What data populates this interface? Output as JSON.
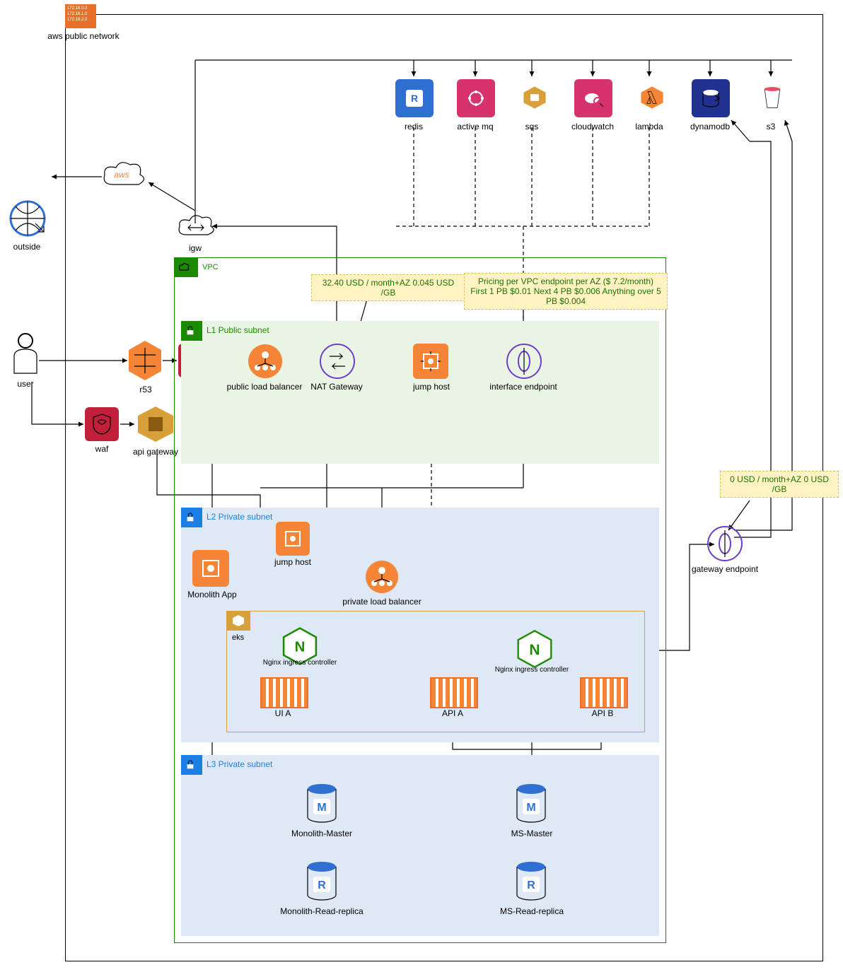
{
  "frame": {
    "aws_public_network": "aws public network"
  },
  "top_services": {
    "redis": "redis",
    "activemq": "active mq",
    "sqs": "sqs",
    "cloudwatch": "cloudwatch",
    "lambda": "lambda",
    "dynamodb": "dynamodb",
    "s3": "s3"
  },
  "left": {
    "outside": "outside",
    "user": "user",
    "aws_cloud": "aws",
    "igw": "igw",
    "r53": "r53",
    "waf": "waf",
    "waf2": "waf",
    "api_gateway": "api gateway"
  },
  "vpc": {
    "label": "VPC",
    "notes": {
      "nat": "32.40 USD /  month+AZ  0.045 USD /GB",
      "ifendpoint": "Pricing per VPC endpoint per AZ ($ 7.2/month) First 1 PB $0.01 Next 4 PB $0.006 Anything over 5 PB $0.004",
      "gwendpoint": "0 USD / month+AZ   0 USD /GB"
    },
    "public_subnet": {
      "label": "L1 Public subnet",
      "plb": "public load balancer",
      "nat": "NAT Gateway",
      "jump": "jump host",
      "ifep": "interface endpoint"
    },
    "private_subnet": {
      "label": "L2 Private subnet",
      "jump": "jump host",
      "monolith": "Monolith App",
      "plb": "private load balancer",
      "eks": "eks",
      "nginx1": "Nginx ingress controller",
      "nginx2": "Nginx ingress controller",
      "ui_a": "UI A",
      "api_a": "API A",
      "api_b": "API B"
    },
    "db_subnet": {
      "label": "L3 Private subnet",
      "mono_master": "Monolith-Master",
      "mono_replica": "Monolith-Read-replica",
      "ms_master": "MS-Master",
      "ms_replica": "MS-Read-replica"
    },
    "gwendpoint": "gateway endpoint"
  }
}
